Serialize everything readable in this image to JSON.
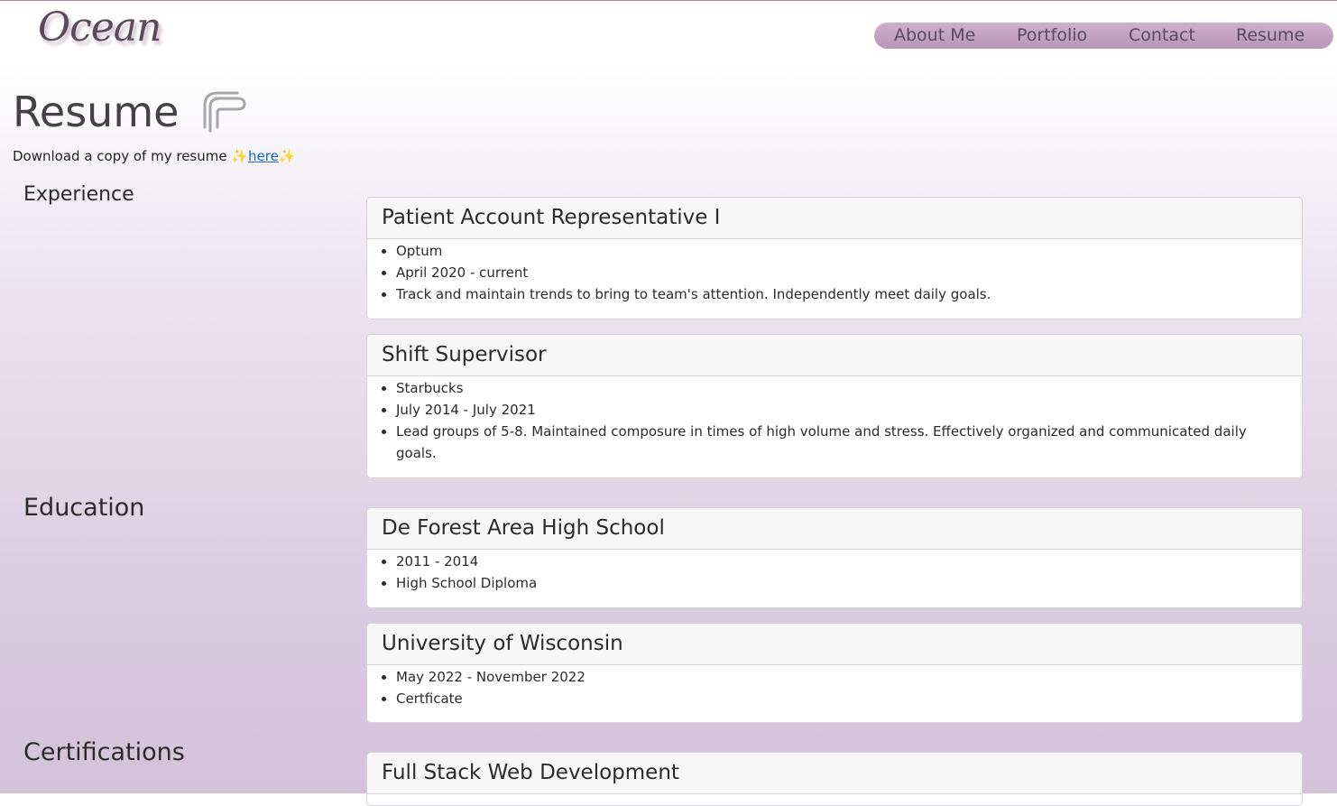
{
  "site": {
    "logo": "Ocean"
  },
  "nav": {
    "items": [
      "About Me",
      "Portfolio",
      "Contact",
      "Resume"
    ]
  },
  "page": {
    "title": "Resume",
    "download_text": "Download a copy of my resume ",
    "sparkle": "✨",
    "download_link": "here"
  },
  "sections": {
    "experience": "Experience",
    "education": "Education",
    "certifications": "Certifications"
  },
  "experience": [
    {
      "title": "Patient Account Representative I",
      "items": [
        "Optum",
        "April 2020 - current",
        "Track and maintain trends to bring to team's attention. Independently meet daily goals."
      ]
    },
    {
      "title": "Shift Supervisor",
      "items": [
        "Starbucks",
        "July 2014 - July 2021",
        "Lead groups of 5-8. Maintained composure in times of high volume and stress. Effectively organized and communicated daily goals."
      ]
    }
  ],
  "education": [
    {
      "title": "De Forest Area High School",
      "items": [
        "2011 - 2014",
        "High School Diploma"
      ]
    },
    {
      "title": "University of Wisconsin",
      "items": [
        "May 2022 - November 2022",
        "Certficate"
      ]
    }
  ],
  "certifications": [
    {
      "title": "Full Stack Web Development"
    }
  ],
  "icons": {
    "title_icon": "paperclip-icon"
  }
}
